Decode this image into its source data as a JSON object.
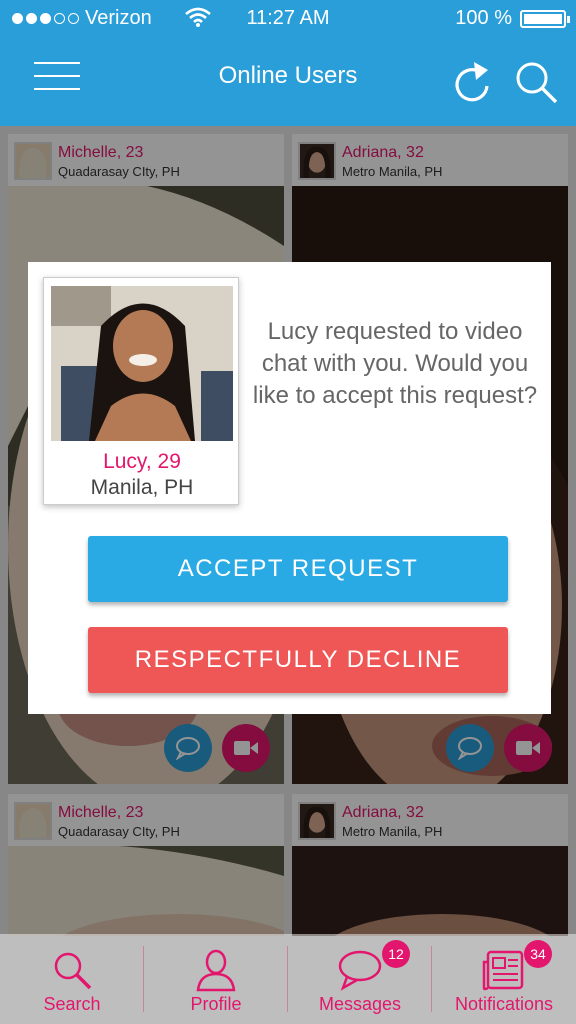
{
  "status_bar": {
    "carrier": "Verizon",
    "time": "11:27 AM",
    "battery": "100 %",
    "battery_level": 1.0,
    "signal_bars": 3
  },
  "header": {
    "title": "Online Users",
    "refresh_icon": "refresh-icon",
    "search_icon": "search-icon",
    "menu_icon": "hamburger-icon"
  },
  "cards": [
    {
      "name": "Michelle, 23",
      "location": "Quadarasay CIty, PH"
    },
    {
      "name": "Adriana, 32",
      "location": "Metro Manila, PH"
    },
    {
      "name": "Michelle, 23",
      "location": "Quadarasay CIty, PH"
    },
    {
      "name": "Adriana, 32",
      "location": "Metro Manila, PH"
    }
  ],
  "dialog": {
    "name": "Lucy, 29",
    "location": "Manila, PH",
    "message": "Lucy requested to video chat with you. Would you like to accept this request?",
    "accept_label": "ACCEPT  REQUEST",
    "decline_label": "RESPECTFULLY  DECLINE"
  },
  "tabs": [
    {
      "label": "Search",
      "icon": "search-icon"
    },
    {
      "label": "Profile",
      "icon": "profile-icon"
    },
    {
      "label": "Messages",
      "icon": "chat-bubble-icon",
      "badge": "12"
    },
    {
      "label": "Notifications",
      "icon": "newspaper-icon",
      "badge": "34"
    }
  ],
  "colors": {
    "brand_blue": "#2a9ed8",
    "accent_pink": "#e3166d",
    "accept": "#2aaae4",
    "decline": "#ef5656"
  }
}
